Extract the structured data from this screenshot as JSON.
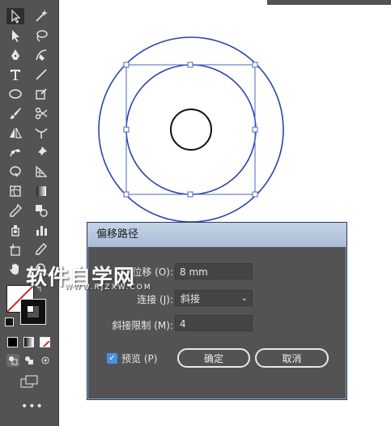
{
  "dialog": {
    "title": "偏移路径",
    "offset_label": "位移 (O):",
    "offset_value": "8 mm",
    "joins_label": "连接 (J):",
    "joins_value": "斜接",
    "miter_label": "斜接限制 (M):",
    "miter_value": "4",
    "preview_label": "预览 (P)",
    "preview_checked": true,
    "ok_label": "确定",
    "cancel_label": "取消"
  },
  "watermark": {
    "title": "软件自学网",
    "url": "WWW.RJZXW.COM"
  },
  "colors": {
    "panel": "#535353",
    "dialog_title": "#b4c4dd",
    "selection": "#2b45a8",
    "checkbox": "#4a90e2"
  },
  "tools": [
    "selection-tool",
    "magic-wand-tool",
    "direct-selection-tool",
    "lasso-tool",
    "pen-tool",
    "curvature-tool",
    "type-tool",
    "line-tool",
    "ellipse-tool",
    "paintbrush-tool",
    "shaper-tool",
    "scissors-tool",
    "rotate-tool",
    "width-tool",
    "puppet-warp-tool",
    "pin-tool",
    "free-transform-tool",
    "perspective-grid-tool",
    "mesh-tool",
    "gradient-tool",
    "eyedropper-tool",
    "blend-tool",
    "symbol-sprayer-tool",
    "column-graph-tool",
    "artboard-tool",
    "slice-tool",
    "hand-tool",
    "zoom-tool"
  ]
}
